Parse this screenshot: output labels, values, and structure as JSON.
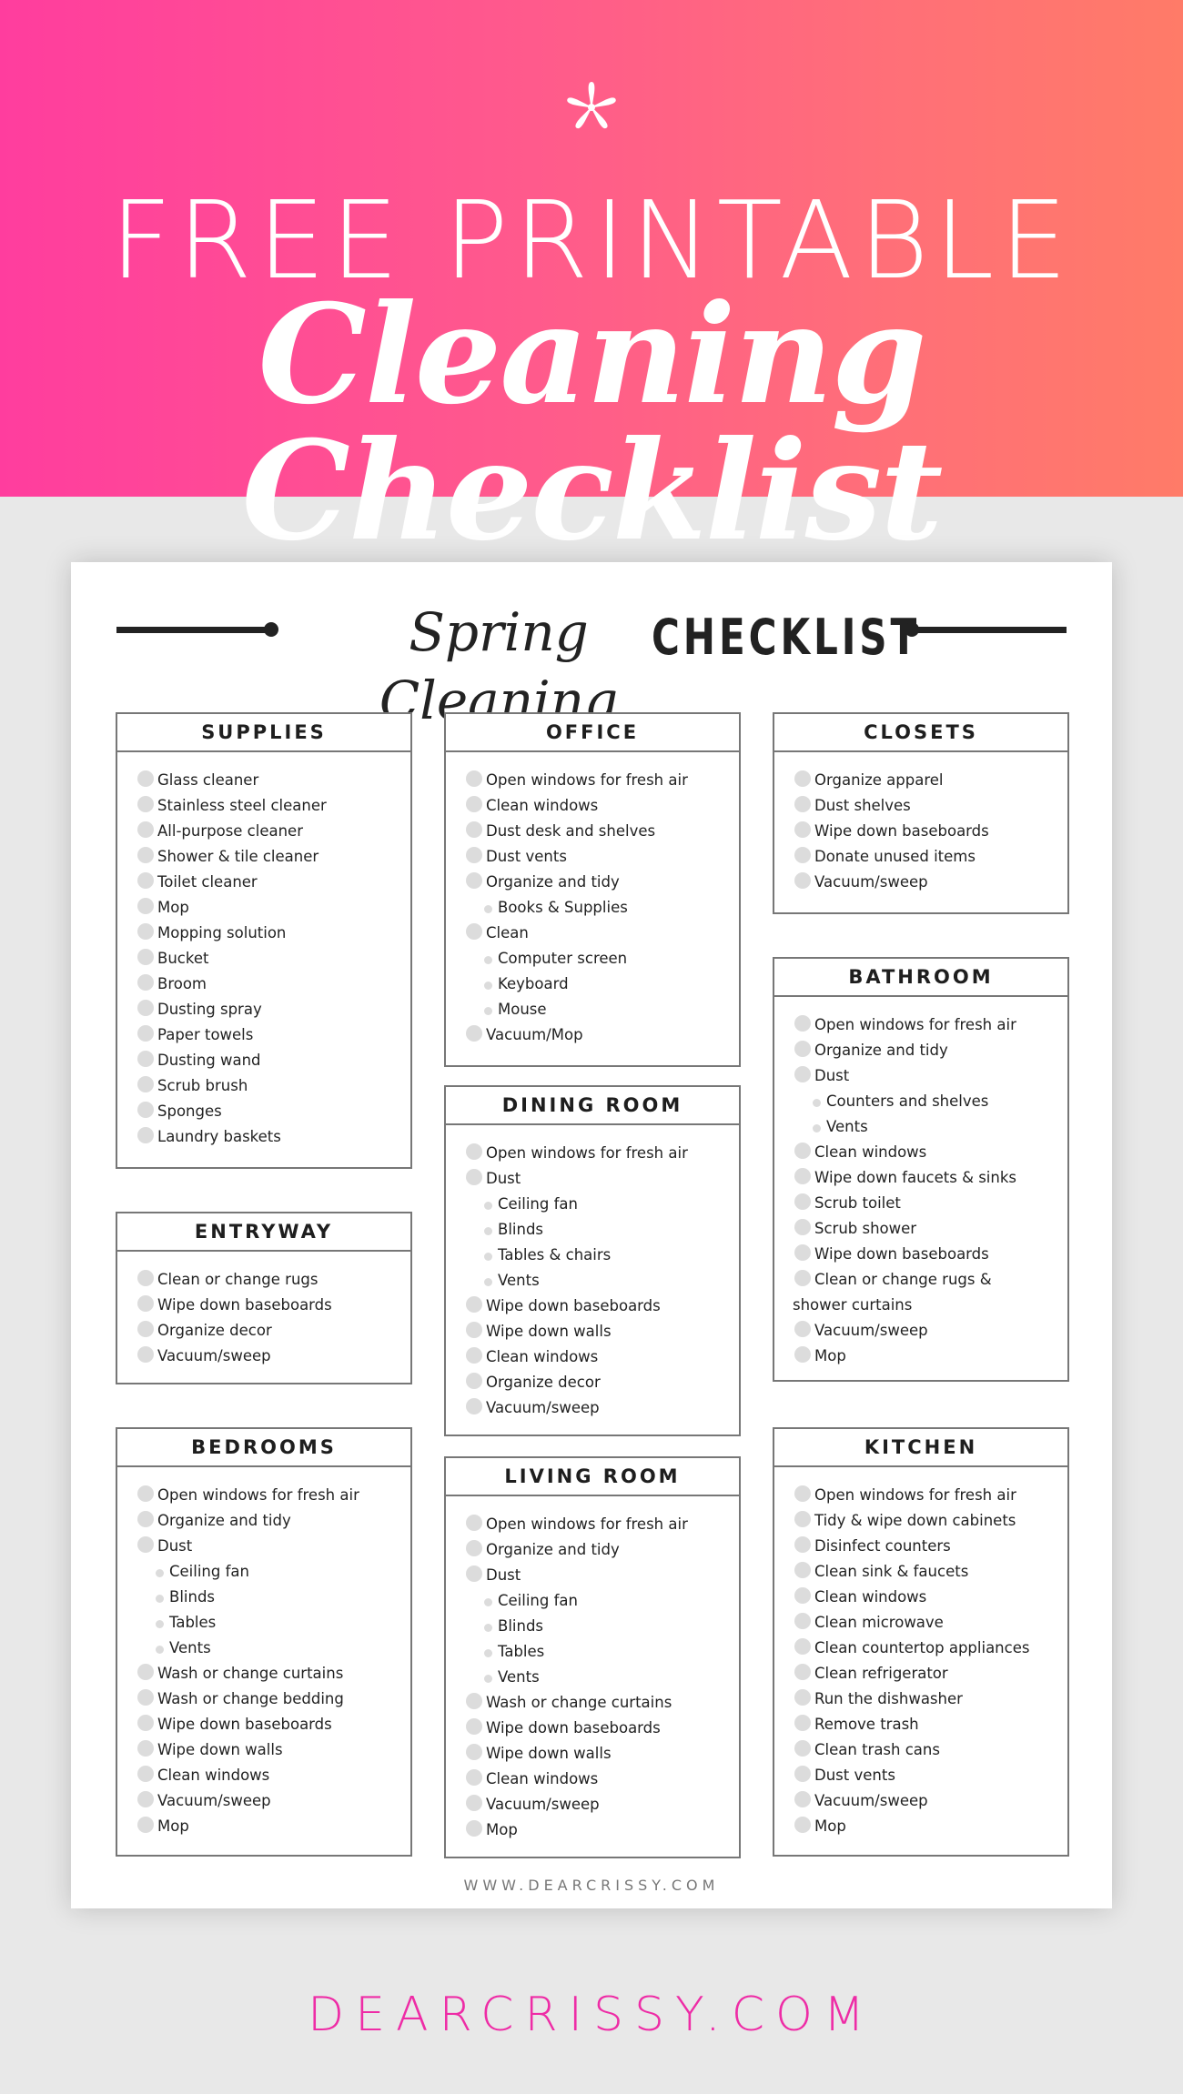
{
  "hero": {
    "icon": "asterisk-icon",
    "line1": "FREE PRINTABLE",
    "line2": "Cleaning Checklist",
    "gradient": [
      "#ff3d9e",
      "#ff7b68"
    ]
  },
  "paper": {
    "title_script": "Spring Cleaning",
    "title_bold": "CHECKLIST",
    "footer": "WWW.DEARCRISSY.COM"
  },
  "sections": {
    "supplies": {
      "title": "SUPPLIES",
      "items": [
        {
          "label": "Glass cleaner"
        },
        {
          "label": "Stainless steel cleaner"
        },
        {
          "label": "All-purpose cleaner"
        },
        {
          "label": "Shower & tile cleaner"
        },
        {
          "label": "Toilet cleaner"
        },
        {
          "label": "Mop"
        },
        {
          "label": "Mopping solution"
        },
        {
          "label": "Bucket"
        },
        {
          "label": "Broom"
        },
        {
          "label": "Dusting spray"
        },
        {
          "label": "Paper towels"
        },
        {
          "label": "Dusting wand"
        },
        {
          "label": "Scrub brush"
        },
        {
          "label": "Sponges"
        },
        {
          "label": "Laundry baskets"
        }
      ]
    },
    "entryway": {
      "title": "ENTRYWAY",
      "items": [
        {
          "label": "Clean or change rugs"
        },
        {
          "label": "Wipe down baseboards"
        },
        {
          "label": "Organize decor"
        },
        {
          "label": "Vacuum/sweep"
        }
      ]
    },
    "bedrooms": {
      "title": "BEDROOMS",
      "items": [
        {
          "label": "Open windows for fresh air"
        },
        {
          "label": "Organize and tidy"
        },
        {
          "label": "Dust"
        },
        {
          "label": "Ceiling fan",
          "sub": true
        },
        {
          "label": "Blinds",
          "sub": true
        },
        {
          "label": "Tables",
          "sub": true
        },
        {
          "label": "Vents",
          "sub": true
        },
        {
          "label": "Wash or change curtains"
        },
        {
          "label": "Wash or change bedding"
        },
        {
          "label": "Wipe down baseboards"
        },
        {
          "label": "Wipe down walls"
        },
        {
          "label": "Clean windows"
        },
        {
          "label": "Vacuum/sweep"
        },
        {
          "label": "Mop"
        }
      ]
    },
    "office": {
      "title": "OFFICE",
      "items": [
        {
          "label": "Open windows for fresh air"
        },
        {
          "label": "Clean windows"
        },
        {
          "label": "Dust desk and shelves"
        },
        {
          "label": "Dust vents"
        },
        {
          "label": "Organize and tidy"
        },
        {
          "label": "Books & Supplies",
          "sub": true
        },
        {
          "label": "Clean"
        },
        {
          "label": "Computer screen",
          "sub": true
        },
        {
          "label": "Keyboard",
          "sub": true
        },
        {
          "label": "Mouse",
          "sub": true
        },
        {
          "label": "Vacuum/Mop"
        }
      ]
    },
    "dining_room": {
      "title": "DINING ROOM",
      "items": [
        {
          "label": "Open windows for fresh air"
        },
        {
          "label": "Dust"
        },
        {
          "label": "Ceiling fan",
          "sub": true
        },
        {
          "label": "Blinds",
          "sub": true
        },
        {
          "label": "Tables & chairs",
          "sub": true
        },
        {
          "label": "Vents",
          "sub": true
        },
        {
          "label": "Wipe down baseboards"
        },
        {
          "label": "Wipe down walls"
        },
        {
          "label": "Clean windows"
        },
        {
          "label": "Organize decor"
        },
        {
          "label": "Vacuum/sweep"
        }
      ]
    },
    "living_room": {
      "title": "LIVING ROOM",
      "items": [
        {
          "label": "Open windows for fresh air"
        },
        {
          "label": "Organize and tidy"
        },
        {
          "label": "Dust"
        },
        {
          "label": "Ceiling fan",
          "sub": true
        },
        {
          "label": "Blinds",
          "sub": true
        },
        {
          "label": "Tables",
          "sub": true
        },
        {
          "label": "Vents",
          "sub": true
        },
        {
          "label": "Wash or change curtains"
        },
        {
          "label": "Wipe down baseboards"
        },
        {
          "label": "Wipe down walls"
        },
        {
          "label": "Clean windows"
        },
        {
          "label": "Vacuum/sweep"
        },
        {
          "label": "Mop"
        }
      ]
    },
    "closets": {
      "title": "CLOSETS",
      "items": [
        {
          "label": "Organize apparel"
        },
        {
          "label": "Dust shelves"
        },
        {
          "label": "Wipe down baseboards"
        },
        {
          "label": "Donate unused items"
        },
        {
          "label": "Vacuum/sweep"
        }
      ]
    },
    "bathroom": {
      "title": "BATHROOM",
      "items": [
        {
          "label": "Open windows for fresh air"
        },
        {
          "label": "Organize and tidy"
        },
        {
          "label": "Dust"
        },
        {
          "label": "Counters and shelves",
          "sub": true
        },
        {
          "label": "Vents",
          "sub": true
        },
        {
          "label": "Clean windows"
        },
        {
          "label": "Wipe down faucets & sinks"
        },
        {
          "label": "Scrub toilet"
        },
        {
          "label": "Scrub shower"
        },
        {
          "label": "Wipe down baseboards"
        },
        {
          "label": "Clean or change rugs & shower curtains",
          "wrap": true
        },
        {
          "label": "Vacuum/sweep"
        },
        {
          "label": "Mop"
        }
      ]
    },
    "kitchen": {
      "title": "KITCHEN",
      "items": [
        {
          "label": "Open windows for fresh air"
        },
        {
          "label": "Tidy & wipe down cabinets"
        },
        {
          "label": "Disinfect counters"
        },
        {
          "label": "Clean sink & faucets"
        },
        {
          "label": "Clean windows"
        },
        {
          "label": "Clean microwave"
        },
        {
          "label": "Clean countertop appliances"
        },
        {
          "label": "Clean refrigerator"
        },
        {
          "label": "Run the dishwasher"
        },
        {
          "label": "Remove trash"
        },
        {
          "label": "Clean trash cans"
        },
        {
          "label": "Dust vents"
        },
        {
          "label": "Vacuum/sweep"
        },
        {
          "label": "Mop"
        }
      ]
    }
  },
  "brand": {
    "text": "DEARCRISSY.COM",
    "color": "#ee2ca6"
  }
}
